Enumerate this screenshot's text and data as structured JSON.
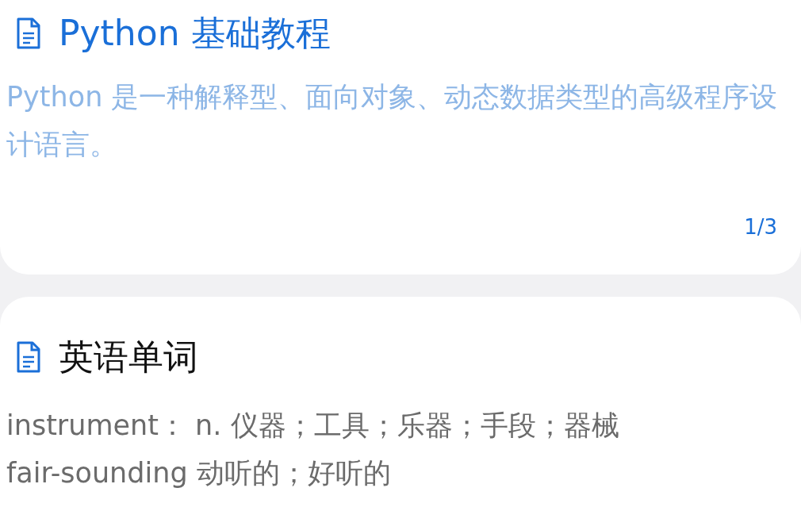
{
  "cards": [
    {
      "kind": "active",
      "title": "Python 基础教程",
      "lines": [
        "Python 是一种解释型、面向对象、动态数据类型的高级程序设计语言。"
      ],
      "pager": "1/3"
    },
    {
      "kind": "plain",
      "title": "英语单词",
      "lines": [
        "instrument： n. 仪器；工具；乐器；手段；器械",
        "fair-sounding 动听的；好听的"
      ]
    }
  ]
}
